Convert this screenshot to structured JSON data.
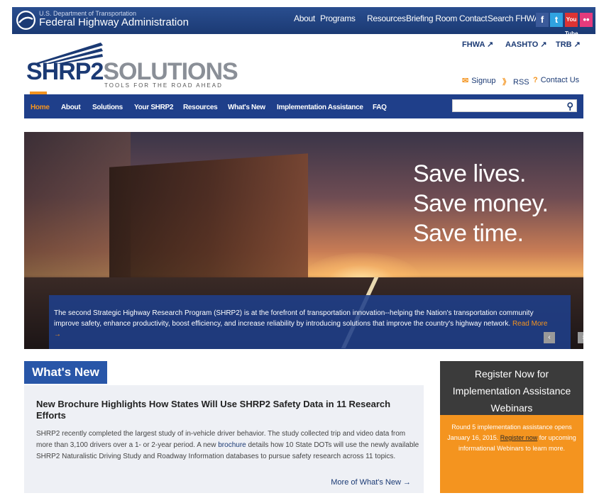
{
  "header": {
    "department": "U.S. Department of Transportation",
    "agency": "Federal Highway Administration",
    "nav": [
      "About",
      "Programs",
      "Resources",
      "Briefing Room",
      "Contact",
      "Search FHWA"
    ],
    "social": [
      "f",
      "t",
      "You Tube",
      "••"
    ]
  },
  "brand_links": [
    "FHWA",
    "AASHTO",
    "TRB"
  ],
  "logo": {
    "word1": "SHRP2",
    "word2": "SOLUTIONS",
    "tagline": "TOOLS FOR THE ROAD AHEAD"
  },
  "utility": {
    "signup": "Signup",
    "rss": "RSS",
    "contact": "Contact Us"
  },
  "main_nav": [
    "Home",
    "About",
    "Solutions",
    "Your SHRP2",
    "Resources",
    "What's New",
    "Implementation Assistance",
    "FAQ"
  ],
  "search": {
    "placeholder": ""
  },
  "hero": {
    "line1": "Save lives.",
    "line2": "Save money.",
    "line3": "Save time.",
    "caption": "The second Strategic Highway Research Program (SHRP2) is at the forefront of transportation innovation--helping the Nation's transportation community improve safety, enhance productivity, boost efficiency, and increase reliability by introducing solutions that improve the country's highway network. ",
    "read_more": "Read More →",
    "prev": "‹",
    "next": "›"
  },
  "whats_new": {
    "tab": "What's New",
    "title": "New Brochure Highlights How States Will Use SHRP2 Safety Data in 11 Research Efforts",
    "body_1": "SHRP2 recently completed the largest study of in-vehicle driver behavior. The study collected trip and video data from more than 3,100 drivers over a 1- or 2-year period. A new ",
    "body_link": "brochure",
    "body_2": " details how 10 State DOTs will use the newly available SHRP2 Naturalistic Driving Study and Roadway Information databases to pursue safety research across 11 topics.",
    "more": "More of What's New →"
  },
  "webinar": {
    "heading": "Register Now for Implementation Assistance Webinars",
    "body_1": "Round 5 implementation assistance opens January 16, 2015. ",
    "link": "Register now",
    "body_2": " for upcoming informational Webinars to learn more."
  },
  "colors": {
    "navy": "#1f3f8a",
    "orange": "#f4941f",
    "dark": "#3b3b3b"
  }
}
